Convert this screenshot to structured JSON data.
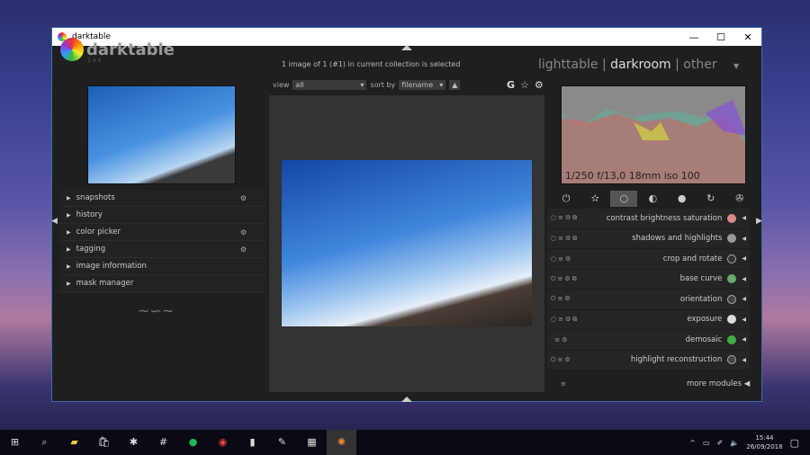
{
  "window": {
    "title": "darktable",
    "min": "—",
    "max": "☐",
    "close": "✕"
  },
  "app": {
    "name": "darktable",
    "version": "2.4.4"
  },
  "status": "1 image of 1 (#1) in current collection is selected",
  "views": {
    "lighttable": "lighttable",
    "sep": "|",
    "darkroom": "darkroom",
    "other": "other"
  },
  "toolbar": {
    "view_label": "view",
    "view_value": "all",
    "sort_label": "sort by",
    "sort_value": "filename",
    "g": "G",
    "star": "☆",
    "gear": "⚙"
  },
  "left_panel": [
    "snapshots",
    "history",
    "color picker",
    "tagging",
    "image information",
    "mask manager"
  ],
  "histogram": {
    "exif": "1/250 f/13,0 18mm iso 100"
  },
  "modules": [
    {
      "name": "contrast brightness saturation",
      "color": "#d88"
    },
    {
      "name": "shadows and highlights",
      "color": "#999"
    },
    {
      "name": "crop and rotate",
      "color": "#333"
    },
    {
      "name": "base curve",
      "color": "#6a6"
    },
    {
      "name": "orientation",
      "color": "#444"
    },
    {
      "name": "exposure",
      "color": "#ddd"
    },
    {
      "name": "demosaic",
      "color": "#4a4"
    },
    {
      "name": "highlight reconstruction",
      "color": "#444"
    }
  ],
  "more_modules": "more modules",
  "taskbar": {
    "time": "15:44",
    "date": "26/09/2018"
  }
}
